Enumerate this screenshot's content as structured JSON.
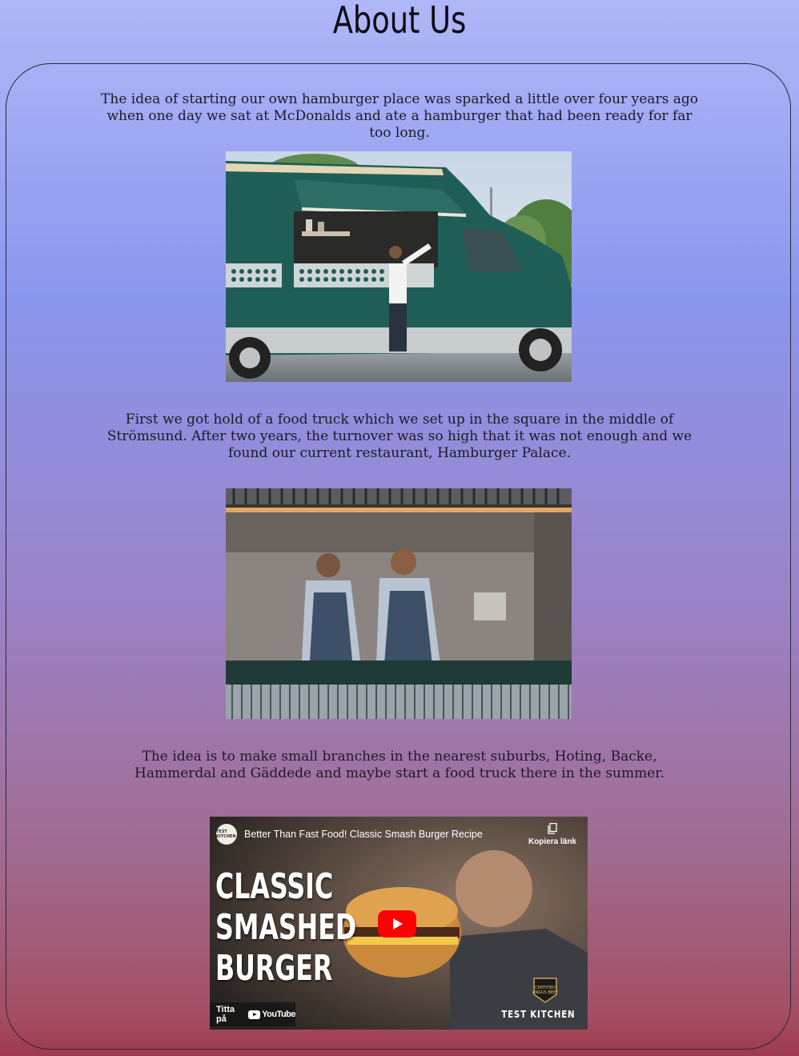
{
  "page": {
    "title": "About Us"
  },
  "content": {
    "paragraphs": [
      "The idea of starting our own hamburger place was sparked a little over four years ago when one day we sat at McDonalds and ate a hamburger that had been ready for far too long.",
      "First we got hold of a food truck which we set up in the square in the middle of Strömsund. After two years, the turnover was so high that it was not enough and we found our current restaurant, Hamburger Palace.",
      "The idea is to make small branches in the nearest suburbs, Hoting, Backe, Hammerdal and Gäddede and maybe start a food truck there in the summer."
    ]
  },
  "video": {
    "title": "Better Than Fast Food! Classic Smash Burger Recipe",
    "copy_label": "Kopiera länk",
    "thumb_lines": [
      "CLASSIC",
      "SMASHED",
      "BURGER"
    ],
    "watch_on": "Titta på",
    "youtube": "YouTube",
    "brand": "TEST KITCHEN",
    "channel_logo_text": "TEST KITCHEN",
    "badge_lines": [
      "CERTIFIED",
      "ANGUS BEEF"
    ]
  },
  "colors": {
    "play_button": "#ff0000",
    "truck_body": "#1f5e57"
  }
}
